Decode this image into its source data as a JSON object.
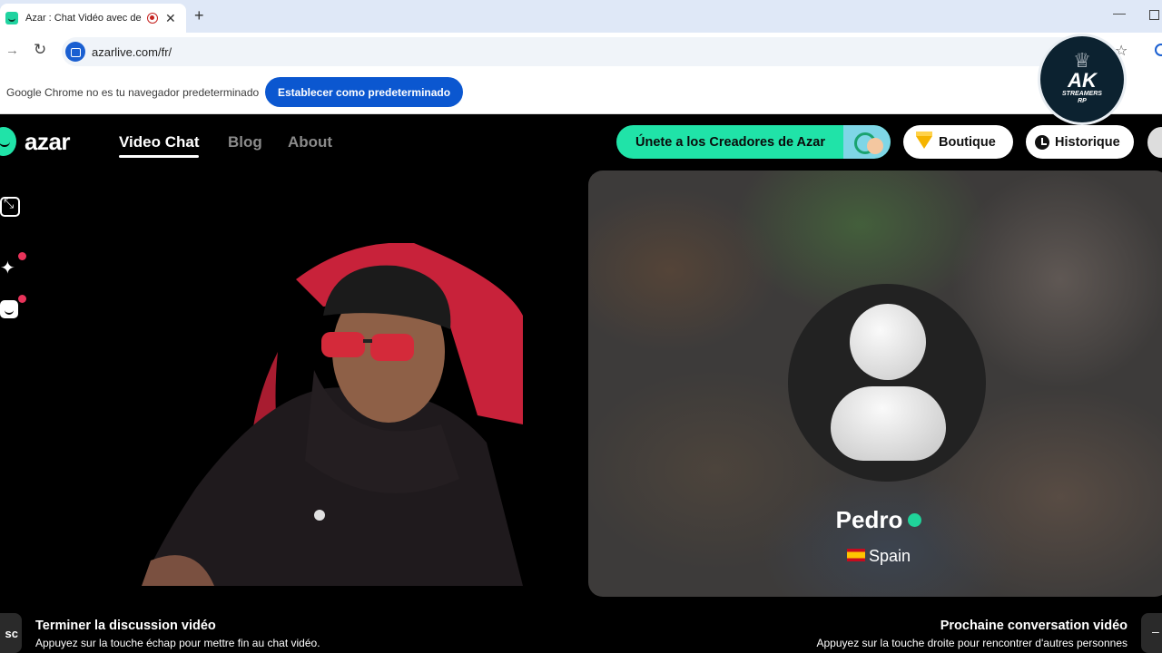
{
  "browser": {
    "tab_title": "Azar : Chat Vidéo avec de n",
    "url": "azarlive.com/fr/",
    "infobar_text": "Google Chrome no es tu navegador predeterminado",
    "infobar_button": "Establecer como predeterminado"
  },
  "watermark": {
    "main": "AK",
    "sub1": "STREAMERS",
    "sub2": "RP"
  },
  "site": {
    "logo_text": "azar",
    "nav": {
      "video_chat": "Video Chat",
      "blog": "Blog",
      "about": "About"
    },
    "creators_button": "Únete a los Creadores de Azar",
    "boutique_button": "Boutique",
    "historique_button": "Historique"
  },
  "partner": {
    "name": "Pedro",
    "country": "Spain"
  },
  "hints": {
    "esc_key": "sc",
    "end_title": "Terminer la discussion vidéo",
    "end_desc": "Appuyez sur la touche échap pour mettre fin au chat vidéo.",
    "next_title": "Prochaine conversation vidéo",
    "next_desc": "Appuyez sur la touche droite pour rencontrer d'autres personnes",
    "next_key": "–"
  },
  "icons": [
    "minimize-icon",
    "sparkle-icon",
    "face-icon",
    "gem-icon",
    "clock-icon",
    "verified-icon",
    "spain-flag-icon"
  ],
  "colors": {
    "brand_green": "#20e3a8",
    "chrome_blue": "#0b57d0",
    "notification_red": "#e8335a"
  }
}
